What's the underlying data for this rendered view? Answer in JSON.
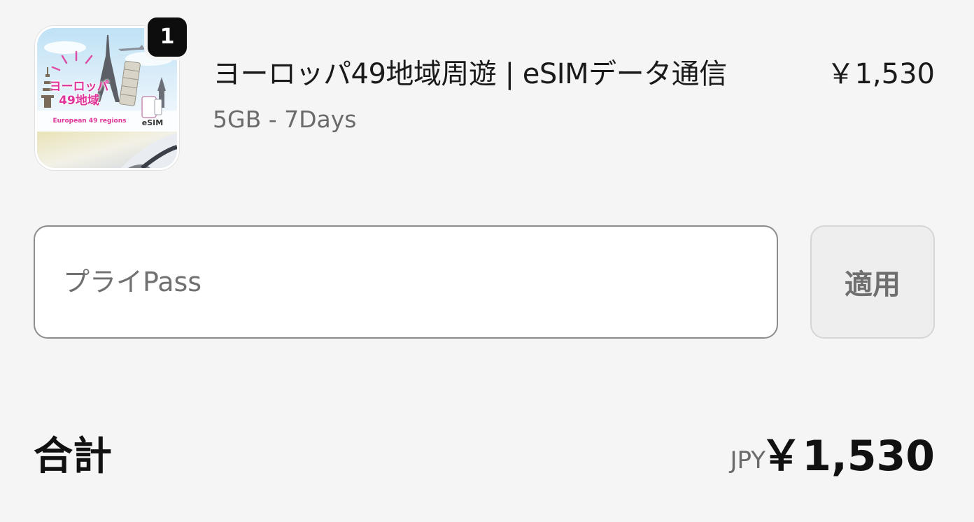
{
  "line_item": {
    "image": {
      "title_text": "ヨーロッパ\n49地域",
      "subtitle_text": "European 49 regions",
      "tag_text": "eSIM",
      "accent_color": "#e0359a"
    },
    "quantity": "1",
    "title": "ヨーロッパ49地域周遊 | eSIMデータ通信",
    "variant": "5GB - 7Days",
    "price": "￥1,530"
  },
  "discount": {
    "placeholder": "プライPass",
    "value": "",
    "apply_label": "適用"
  },
  "total": {
    "label": "合計",
    "currency": "JPY",
    "amount": "￥1,530"
  },
  "colors": {
    "background": "#f5f5f5",
    "badge": "#0d0d0d",
    "input_border": "#8c8c8c",
    "button_bg": "#eeeeee",
    "muted_text": "#6b6b6b"
  }
}
